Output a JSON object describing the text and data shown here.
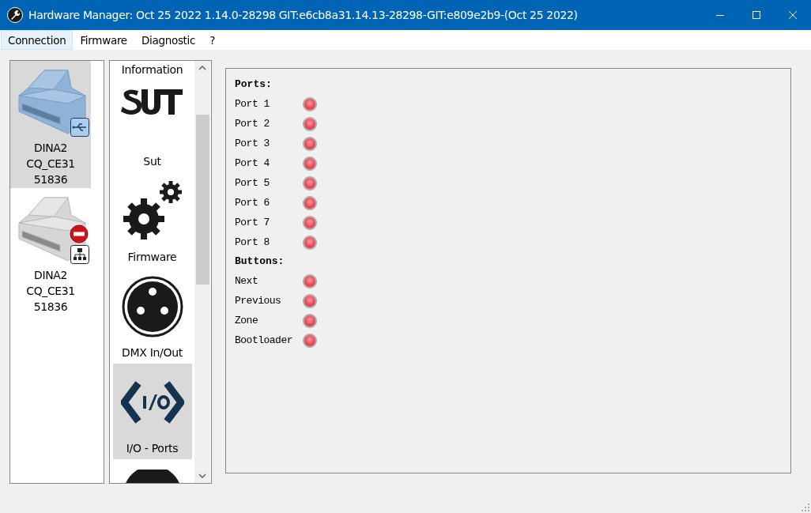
{
  "window": {
    "title": "Hardware Manager: Oct 25 2022 1.14.0-28298 GIT:e6cb8a31.14.13-28298-GIT:e809e2b9-(Oct 25 2022)"
  },
  "menu": [
    {
      "label": "Connection",
      "selected": true
    },
    {
      "label": "Firmware",
      "selected": false
    },
    {
      "label": "Diagnostic",
      "selected": false
    },
    {
      "label": "?",
      "selected": false
    }
  ],
  "devices": [
    {
      "lines": [
        "DINA2",
        "CQ_CE31",
        "51836"
      ],
      "selected": true,
      "kind": "usb",
      "error": false
    },
    {
      "lines": [
        "DINA2",
        "CQ_CE31",
        "51836"
      ],
      "selected": false,
      "kind": "network",
      "error": true
    }
  ],
  "modules": [
    {
      "label": "Information",
      "kind": "information",
      "selected": false
    },
    {
      "label": "Sut",
      "kind": "sut",
      "selected": false
    },
    {
      "label": "Firmware",
      "kind": "firmware",
      "selected": false
    },
    {
      "label": "DMX In/Out",
      "kind": "dmx",
      "selected": false
    },
    {
      "label": "I/O - Ports",
      "kind": "io",
      "selected": true
    }
  ],
  "sections": [
    {
      "title": "Ports:",
      "items": [
        {
          "label": "Port 1",
          "on": false
        },
        {
          "label": "Port 2",
          "on": false
        },
        {
          "label": "Port 3",
          "on": false
        },
        {
          "label": "Port 4",
          "on": false
        },
        {
          "label": "Port 5",
          "on": false
        },
        {
          "label": "Port 6",
          "on": false
        },
        {
          "label": "Port 7",
          "on": false
        },
        {
          "label": "Port 8",
          "on": false
        }
      ]
    },
    {
      "title": "Buttons:",
      "items": [
        {
          "label": "Next",
          "on": false
        },
        {
          "label": "Previous",
          "on": false
        },
        {
          "label": "Zone",
          "on": false
        },
        {
          "label": "Bootloader",
          "on": false
        }
      ]
    }
  ]
}
